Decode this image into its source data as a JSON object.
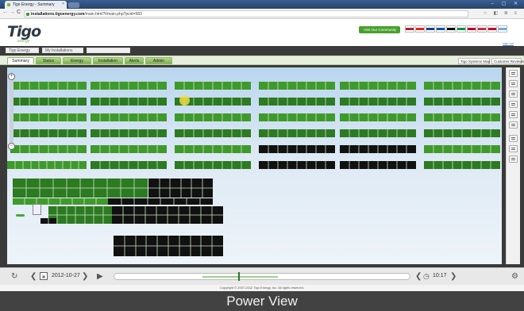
{
  "browser": {
    "tab_title": "Tigo Energy - Summary",
    "tab_close": "×",
    "url_host": "installations.tigoenergy.com",
    "url_path": "/main.html?t/main.php?pvid=583",
    "back_glyph": "←",
    "forward_glyph": "→",
    "reload_glyph": "C",
    "window_controls": "– ▢ ✕",
    "right_icons": "☆ ◧ ⊕ ≡"
  },
  "header": {
    "logo": "Tigo",
    "logo_sub": "energy",
    "visit_button": "Visit Our Community",
    "sign_out": "sign out",
    "flag_colors": [
      "#b22234",
      "#d52b1e",
      "#11457e",
      "#0055a4",
      "#000000",
      "#009246",
      "#bc002d",
      "#cd2e3a",
      "#c60b1e",
      "#6cace4"
    ]
  },
  "breadcrumbs": [
    "Tigo Energy",
    "My Installations",
    ""
  ],
  "tabs": [
    {
      "label": "Summary"
    },
    {
      "label": "Status"
    },
    {
      "label": "Energy"
    },
    {
      "label": "Installation"
    },
    {
      "label": "Alerts"
    },
    {
      "label": "Admin"
    }
  ],
  "right_links": [
    "Tigo Systems Map",
    "Customer Reviews"
  ],
  "zoom": {
    "in_glyph": "+",
    "out_glyph": "−"
  },
  "bottom": {
    "refresh_glyph": "↻",
    "prev_glyph": "❮",
    "next_glyph": "❯",
    "calendar_glyph": "▦",
    "date": "2012-10-27",
    "play_glyph": "▶",
    "time": "10:17",
    "clock_glyph": "◷",
    "settings_glyph": "⚙"
  },
  "copyright": "Copyright © 2007-2012 Tigo Energy, Inc. All rights reserved.",
  "caption": "Power View"
}
